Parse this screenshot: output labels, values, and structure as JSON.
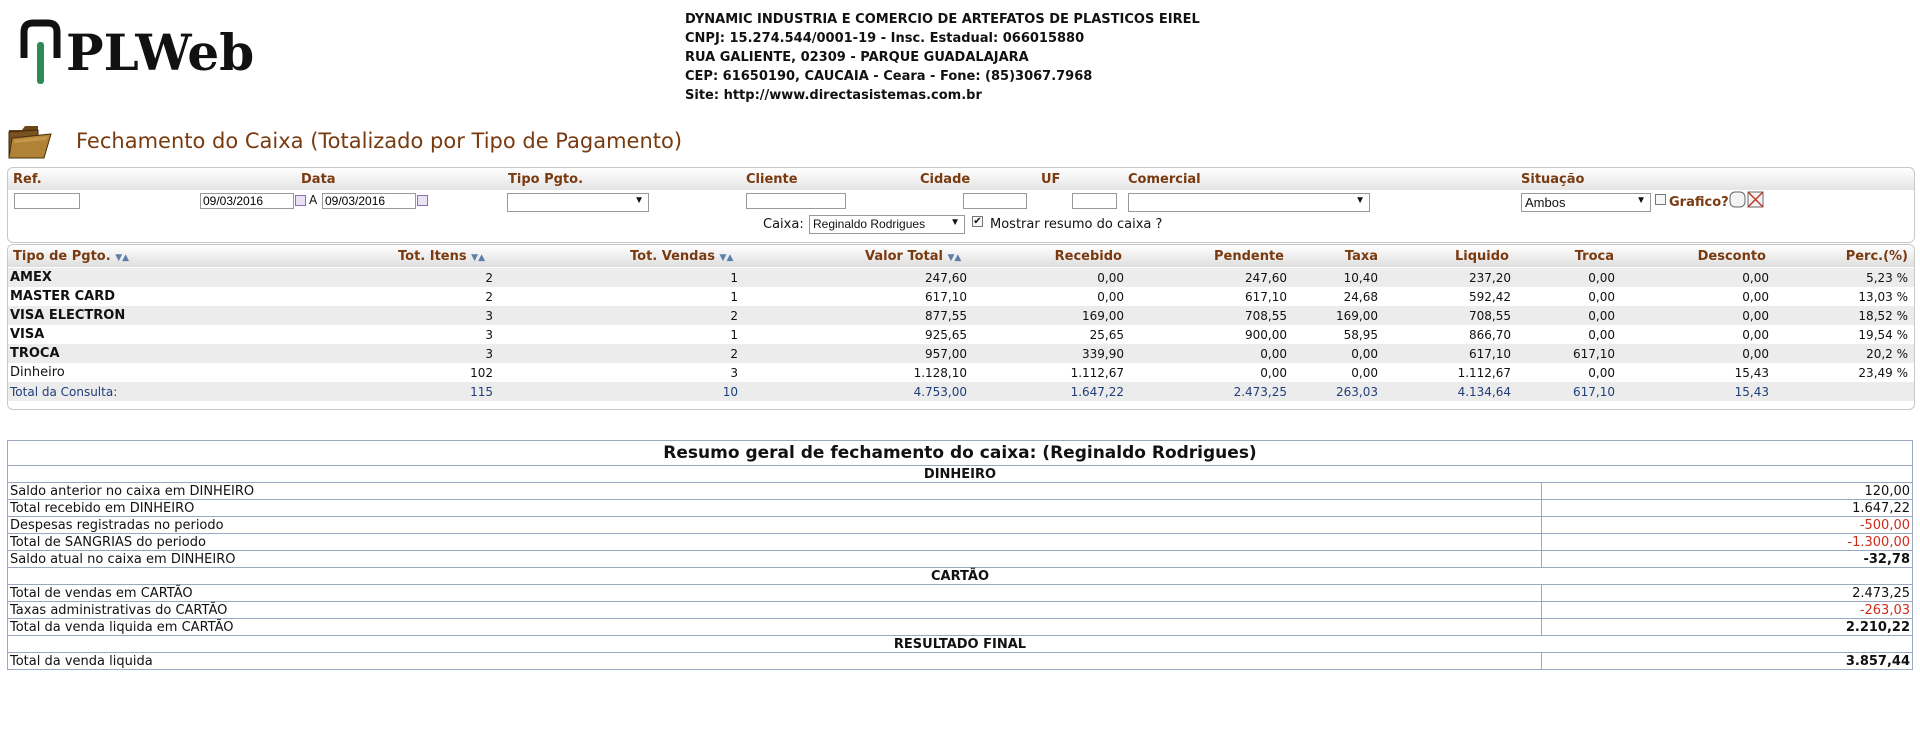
{
  "logo": {
    "text": "PLWeb"
  },
  "company": {
    "lines": [
      "DYNAMIC INDUSTRIA E COMERCIO DE ARTEFATOS DE PLASTICOS EIREL",
      "CNPJ: 15.274.544/0001-19 - Insc. Estadual: 066015880",
      "RUA GALIENTE, 02309 - PARQUE GUADALAJARA",
      "CEP: 61650190, CAUCAIA - Ceara - Fone: (85)3067.7968",
      "Site: http://www.directasistemas.com.br"
    ]
  },
  "page_title": "Fechamento do Caixa (Totalizado por Tipo de Pagamento)",
  "filters": {
    "labels": {
      "ref": "Ref.",
      "data": "Data",
      "tipo_pgto": "Tipo Pgto.",
      "cliente": "Cliente",
      "cidade": "Cidade",
      "uf": "UF",
      "comercial": "Comercial",
      "situacao": "Situação"
    },
    "date_from": "09/03/2016",
    "date_sep": "A",
    "date_to": "09/03/2016",
    "tipo_pgto_value": "",
    "comercial_value": "",
    "situacao_value": "Ambos",
    "grafico_label": "Grafico?",
    "caixa_label": "Caixa:",
    "caixa_value": "Reginaldo Rodrigues",
    "mostrar_resumo_label": "Mostrar resumo do caixa ?",
    "mostrar_resumo_checked": true
  },
  "table": {
    "headers": {
      "tipo": "Tipo de Pgto.",
      "itens": "Tot. Itens",
      "vendas": "Tot. Vendas",
      "valor": "Valor Total",
      "recebido": "Recebido",
      "pendente": "Pendente",
      "taxa": "Taxa",
      "liquido": "Liquido",
      "troca": "Troca",
      "desconto": "Desconto",
      "perc": "Perc.(%)"
    },
    "rows": [
      {
        "tipo": "AMEX",
        "itens": "2",
        "vendas": "1",
        "valor": "247,60",
        "recebido": "0,00",
        "pendente": "247,60",
        "taxa": "10,40",
        "liquido": "237,20",
        "troca": "0,00",
        "desconto": "0,00",
        "perc": "5,23 %"
      },
      {
        "tipo": "MASTER CARD",
        "itens": "2",
        "vendas": "1",
        "valor": "617,10",
        "recebido": "0,00",
        "pendente": "617,10",
        "taxa": "24,68",
        "liquido": "592,42",
        "troca": "0,00",
        "desconto": "0,00",
        "perc": "13,03 %"
      },
      {
        "tipo": "VISA ELECTRON",
        "itens": "3",
        "vendas": "2",
        "valor": "877,55",
        "recebido": "169,00",
        "pendente": "708,55",
        "taxa": "169,00",
        "liquido": "708,55",
        "troca": "0,00",
        "desconto": "0,00",
        "perc": "18,52 %"
      },
      {
        "tipo": "VISA",
        "itens": "3",
        "vendas": "1",
        "valor": "925,65",
        "recebido": "25,65",
        "pendente": "900,00",
        "taxa": "58,95",
        "liquido": "866,70",
        "troca": "0,00",
        "desconto": "0,00",
        "perc": "19,54 %"
      },
      {
        "tipo": "TROCA",
        "itens": "3",
        "vendas": "2",
        "valor": "957,00",
        "recebido": "339,90",
        "pendente": "0,00",
        "taxa": "0,00",
        "liquido": "617,10",
        "troca": "617,10",
        "desconto": "0,00",
        "perc": "20,2 %"
      },
      {
        "tipo": "Dinheiro",
        "itens": "102",
        "vendas": "3",
        "valor": "1.128,10",
        "recebido": "1.112,67",
        "pendente": "0,00",
        "taxa": "0,00",
        "liquido": "1.112,67",
        "troca": "0,00",
        "desconto": "15,43",
        "perc": "23,49 %"
      }
    ],
    "total": {
      "tipo": "Total da Consulta:",
      "itens": "115",
      "vendas": "10",
      "valor": "4.753,00",
      "recebido": "1.647,22",
      "pendente": "2.473,25",
      "taxa": "263,03",
      "liquido": "4.134,64",
      "troca": "617,10",
      "desconto": "15,43",
      "perc": ""
    }
  },
  "summary": {
    "title": "Resumo geral de fechamento do caixa: (Reginaldo Rodrigues)",
    "dinheiro_title": "DINHEIRO",
    "saldo_anterior_label": "Saldo anterior no caixa em DINHEIRO",
    "saldo_anterior_value": "120,00",
    "total_recebido_label": "Total recebido em DINHEIRO",
    "total_recebido_value": "1.647,22",
    "despesas_label": "Despesas registradas no periodo",
    "despesas_value": "-500,00",
    "sangrias_label": "Total de SANGRIAS do periodo",
    "sangrias_value": "-1.300,00",
    "saldo_atual_label": "Saldo atual no caixa em DINHEIRO",
    "saldo_atual_value": "-32,78",
    "cartao_title": "CARTÃO",
    "vendas_cartao_label": "Total de vendas em CARTÃO",
    "vendas_cartao_value": "2.473,25",
    "taxas_label": "Taxas administrativas do CARTÃO",
    "taxas_value": "-263,03",
    "liquida_cartao_label": "Total da venda liquida em CARTÃO",
    "liquida_cartao_value": "2.210,22",
    "resultado_title": "RESULTADO FINAL",
    "liquida_total_label": "Total da venda liquida",
    "liquida_total_value": "3.857,44"
  },
  "colors": {
    "accent": "#7a3a10",
    "negative": "#d12a1a",
    "total_text": "#1f3e7a",
    "logo_green": "#2e8b57"
  }
}
